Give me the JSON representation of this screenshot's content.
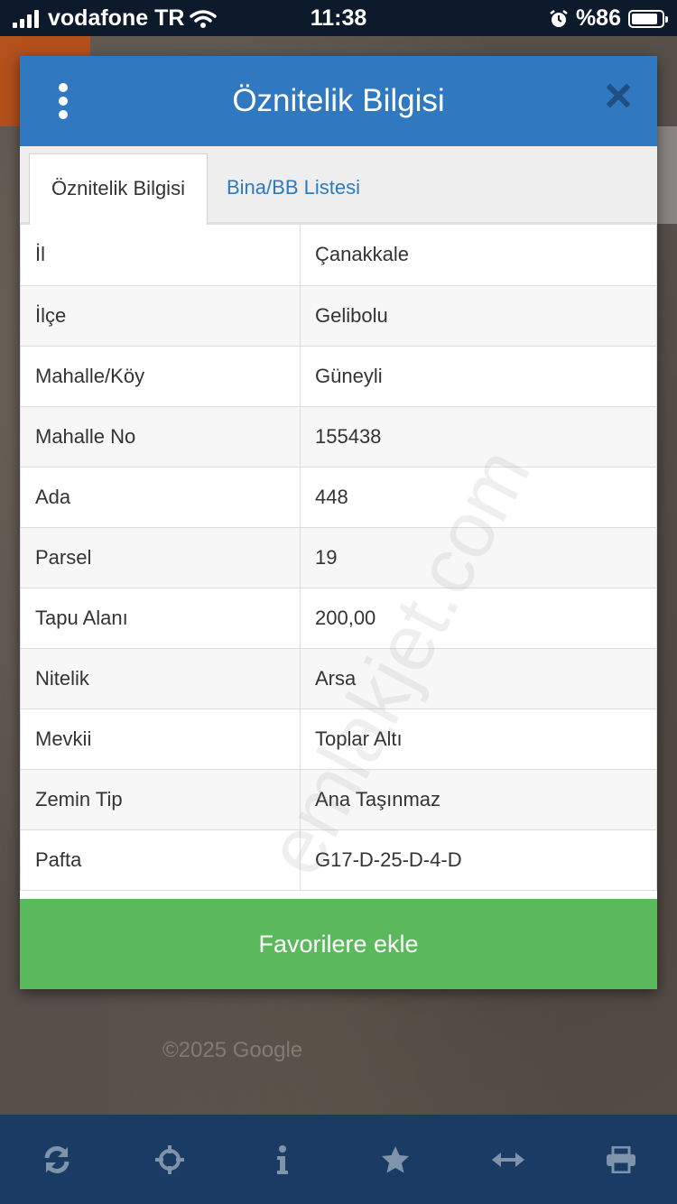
{
  "status_bar": {
    "carrier": "vodafone TR",
    "time": "11:38",
    "battery": "%86",
    "battery_level": 0.86
  },
  "modal": {
    "title": "Öznitelik Bilgisi",
    "tabs": [
      {
        "label": "Öznitelik Bilgisi",
        "active": true
      },
      {
        "label": "Bina/BB Listesi",
        "active": false
      }
    ],
    "rows": [
      {
        "key": "İl",
        "value": "Çanakkale"
      },
      {
        "key": "İlçe",
        "value": "Gelibolu"
      },
      {
        "key": "Mahalle/Köy",
        "value": "Güneyli"
      },
      {
        "key": "Mahalle No",
        "value": "155438"
      },
      {
        "key": "Ada",
        "value": "448"
      },
      {
        "key": "Parsel",
        "value": "19"
      },
      {
        "key": "Tapu Alanı",
        "value": "200,00"
      },
      {
        "key": "Nitelik",
        "value": "Arsa"
      },
      {
        "key": "Mevkii",
        "value": "Toplar Altı"
      },
      {
        "key": "Zemin Tip",
        "value": "Ana Taşınmaz"
      },
      {
        "key": "Pafta",
        "value": "G17-D-25-D-4-D"
      }
    ],
    "favorite_button": "Favorilere ekle"
  },
  "watermark": "emlakjet.com",
  "map_attribution": "©2025 Google",
  "toolbar_icons": [
    "refresh-icon",
    "crosshair-icon",
    "info-icon",
    "star-icon",
    "measure-icon",
    "print-icon"
  ],
  "colors": {
    "header_blue": "#3079c0",
    "button_green": "#5cb85c",
    "toolbar_navy": "#1a3c64",
    "link_blue": "#2f79be"
  }
}
